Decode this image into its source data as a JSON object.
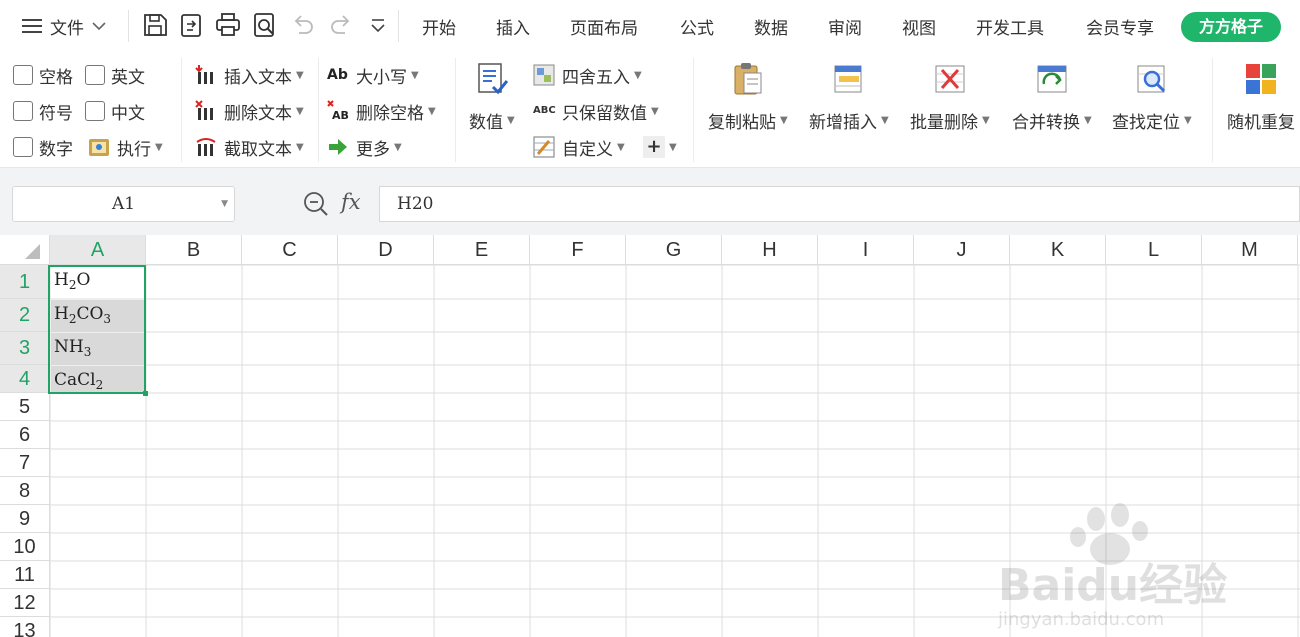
{
  "menubar": {
    "file_label": "文件",
    "tabs": [
      "开始",
      "插入",
      "页面布局",
      "公式",
      "数据",
      "审阅",
      "视图",
      "开发工具",
      "会员专享"
    ],
    "vip_tab": "方方格子",
    "quick_icons": [
      "save-icon",
      "export-icon",
      "print-icon",
      "print-preview-icon",
      "undo-icon",
      "redo-icon",
      "more-icon"
    ]
  },
  "ribbon": {
    "checkboxes": [
      "空格",
      "英文",
      "符号",
      "中文",
      "数字"
    ],
    "execute": "执行",
    "text_ops": [
      "插入文本",
      "删除文本",
      "截取文本"
    ],
    "case_ops": [
      "大小写",
      "删除空格",
      "更多"
    ],
    "number": "数值",
    "round_ops": [
      "四舍五入",
      "只保留数值",
      "自定义"
    ],
    "plus": "+",
    "big_buttons": [
      "复制粘贴",
      "新增插入",
      "批量删除",
      "合并转换",
      "查找定位",
      "随机重复"
    ]
  },
  "formula_bar": {
    "cell_ref": "A1",
    "fx": "fx",
    "value": "H20"
  },
  "sheet": {
    "columns": [
      "A",
      "B",
      "C",
      "D",
      "E",
      "F",
      "G",
      "H",
      "I",
      "J",
      "K",
      "L",
      "M"
    ],
    "rows": [
      "1",
      "2",
      "3",
      "4",
      "5",
      "6",
      "7",
      "8",
      "9",
      "10",
      "11",
      "12",
      "13"
    ],
    "cells": [
      {
        "ref": "A1",
        "parts": [
          "H",
          "2",
          "O"
        ]
      },
      {
        "ref": "A2",
        "parts": [
          "H",
          "2",
          "CO",
          "3"
        ]
      },
      {
        "ref": "A3",
        "parts": [
          "NH",
          "3"
        ]
      },
      {
        "ref": "A4",
        "parts": [
          "CaCl",
          "2"
        ]
      }
    ]
  },
  "watermark": "Baidu经验 jingyan.baidu.com",
  "colors": {
    "accent": "#1fb56b",
    "selection": "#21a366",
    "selected_fill": "#d9d9d9"
  }
}
